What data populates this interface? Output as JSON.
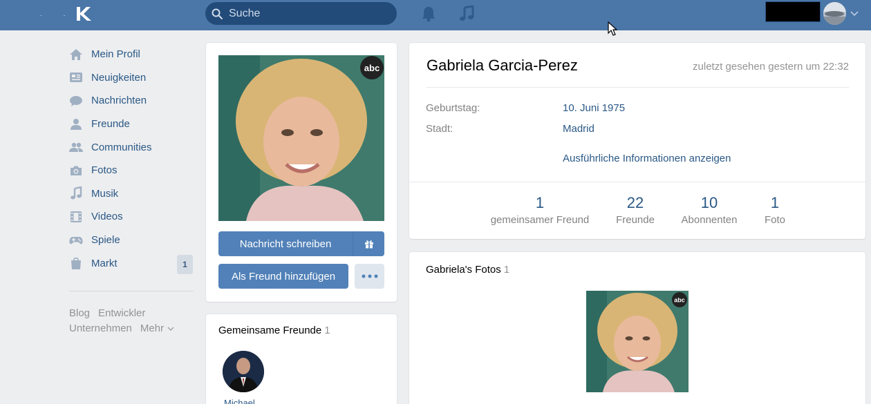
{
  "header": {
    "search_placeholder": "Suche",
    "brand_color": "#4a76a8"
  },
  "nav": {
    "items": [
      {
        "label": "Mein Profil",
        "icon": "home-icon"
      },
      {
        "label": "Neuigkeiten",
        "icon": "news-icon"
      },
      {
        "label": "Nachrichten",
        "icon": "chat-icon"
      },
      {
        "label": "Freunde",
        "icon": "user-icon"
      },
      {
        "label": "Communities",
        "icon": "users-icon"
      },
      {
        "label": "Fotos",
        "icon": "camera-icon"
      },
      {
        "label": "Musik",
        "icon": "music-icon"
      },
      {
        "label": "Videos",
        "icon": "film-icon"
      },
      {
        "label": "Spiele",
        "icon": "gamepad-icon"
      },
      {
        "label": "Markt",
        "icon": "bag-icon",
        "badge": "1"
      }
    ],
    "footer": {
      "blog": "Blog",
      "dev": "Entwickler",
      "company": "Unternehmen",
      "more": "Mehr"
    }
  },
  "profile": {
    "buttons": {
      "message": "Nachricht schreiben",
      "add_friend": "Als Freund hinzufügen"
    },
    "mutual": {
      "title": "Gemeinsame Freunde",
      "count": "1",
      "friend_name": "Michael"
    }
  },
  "info": {
    "name": "Gabriela Garcia-Perez",
    "last_seen": "zuletzt gesehen gestern um 22:32",
    "birthday_label": "Geburtstag:",
    "birthday": "10. Juni 1975",
    "city_label": "Stadt:",
    "city": "Madrid",
    "more_info": "Ausführliche Informationen anzeigen",
    "stats": [
      {
        "num": "1",
        "cap": "gemeinsamer Freund"
      },
      {
        "num": "22",
        "cap": "Freunde"
      },
      {
        "num": "10",
        "cap": "Abonnenten"
      },
      {
        "num": "1",
        "cap": "Foto"
      }
    ]
  },
  "photos": {
    "title": "Gabriela's Fotos",
    "count": "1"
  }
}
